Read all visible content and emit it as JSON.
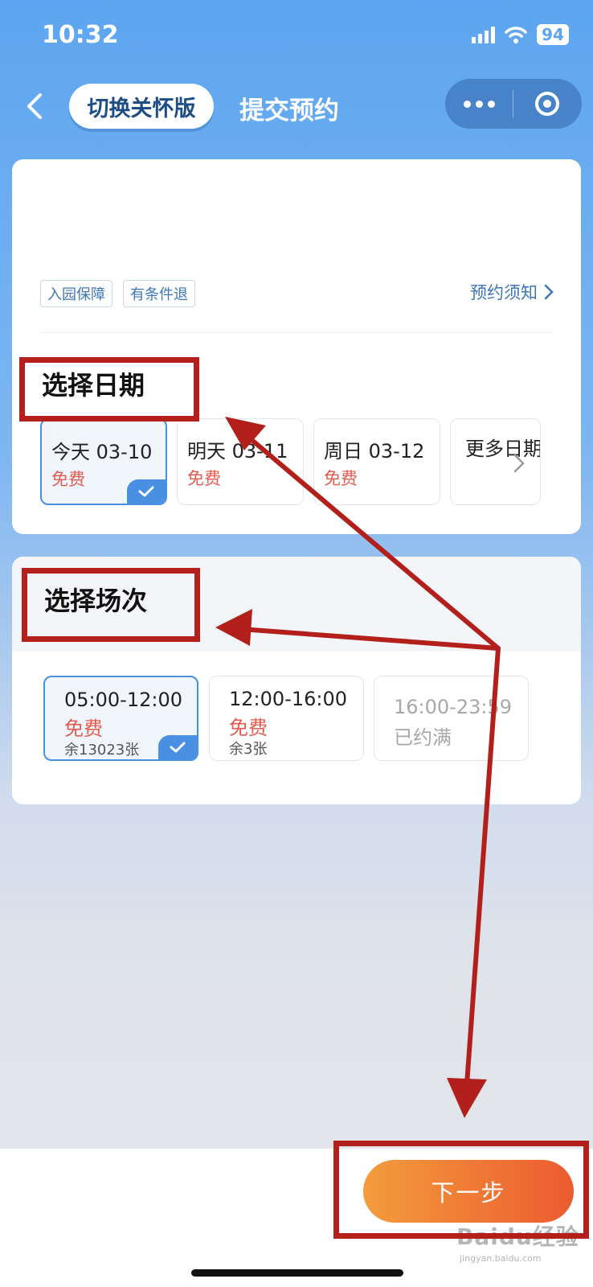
{
  "status_bar": {
    "time": "10:32",
    "battery": "94"
  },
  "nav": {
    "care_button": "切换关怀版",
    "title": "提交预约"
  },
  "booking": {
    "tags": [
      "入园保障",
      "有条件退"
    ],
    "notice_link": "预约须知",
    "date_section_title": "选择日期",
    "dates": [
      {
        "label": "今天 03-10",
        "price": "免费",
        "selected": true
      },
      {
        "label": "明天 03-11",
        "price": "免费",
        "selected": false
      },
      {
        "label": "周日 03-12",
        "price": "免费",
        "selected": false
      }
    ],
    "more_dates": "更多日期",
    "session_section_title": "选择场次",
    "sessions": [
      {
        "time": "05:00-12:00",
        "price": "免费",
        "remaining": "余13023张",
        "selected": true
      },
      {
        "time": "12:00-16:00",
        "price": "免费",
        "remaining": "余3张",
        "selected": false
      },
      {
        "time": "16:00-23:59",
        "status": "已约满",
        "selected": false
      }
    ]
  },
  "footer": {
    "next_button": "下一步"
  },
  "watermark": {
    "brand": "Baidu经验",
    "sub": "jingyan.baidu.com"
  },
  "colors": {
    "accent": "#4a90e2",
    "price": "#e55a4e",
    "annotation": "#b3201b",
    "button_start": "#f39c3c",
    "button_end": "#ec5b30"
  }
}
